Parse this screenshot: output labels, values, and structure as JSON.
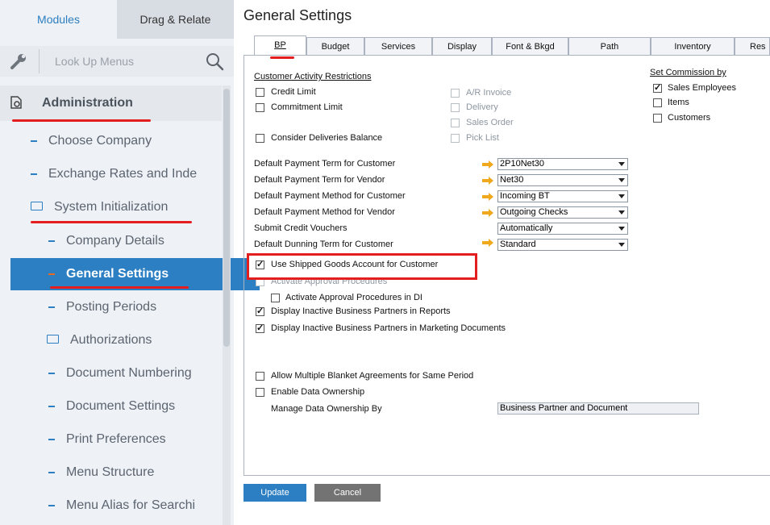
{
  "left": {
    "tabs": [
      {
        "label": "Modules"
      },
      {
        "label": "Drag & Relate"
      }
    ],
    "lookup_label": "Look Up Menus",
    "section": "Administration",
    "items": [
      {
        "label": "Choose Company"
      },
      {
        "label": "Exchange Rates and Inde"
      },
      {
        "label": "System Initialization"
      },
      {
        "label": "Company Details"
      },
      {
        "label": "General Settings"
      },
      {
        "label": "Posting Periods"
      },
      {
        "label": "Authorizations"
      },
      {
        "label": "Document Numbering"
      },
      {
        "label": "Document Settings"
      },
      {
        "label": "Print Preferences"
      },
      {
        "label": "Menu Structure"
      },
      {
        "label": "Menu Alias for Searchi"
      }
    ]
  },
  "right": {
    "title": "General Settings",
    "tabs": [
      {
        "label": "BP"
      },
      {
        "label": "Budget"
      },
      {
        "label": "Services"
      },
      {
        "label": "Display"
      },
      {
        "label": "Font & Bkgd"
      },
      {
        "label": "Path"
      },
      {
        "label": "Inventory"
      },
      {
        "label": "Res"
      }
    ],
    "car_header": "Customer Activity Restrictions",
    "car_items": [
      {
        "label": "Credit Limit",
        "checked": false
      },
      {
        "label": "Commitment Limit",
        "checked": false
      },
      {
        "label": "Consider Deliveries Balance",
        "checked": false
      }
    ],
    "car_docs": [
      {
        "label": "A/R Invoice"
      },
      {
        "label": "Delivery"
      },
      {
        "label": "Sales Order"
      },
      {
        "label": "Pick List"
      }
    ],
    "commission_header": "Set Commission by",
    "commission": [
      {
        "label": "Sales Employees",
        "checked": true
      },
      {
        "label": "Items",
        "checked": false
      },
      {
        "label": "Customers",
        "checked": false
      }
    ],
    "defaults": [
      {
        "label": "Default Payment Term for Customer",
        "value": "2P10Net30",
        "arrow": true
      },
      {
        "label": "Default Payment Term for Vendor",
        "value": "Net30",
        "arrow": true
      },
      {
        "label": "Default Payment Method for Customer",
        "value": "Incoming BT",
        "arrow": true
      },
      {
        "label": "Default Payment Method for Vendor",
        "value": "Outgoing Checks",
        "arrow": true
      },
      {
        "label": "Submit Credit Vouchers",
        "value": "Automatically",
        "arrow": false
      },
      {
        "label": "Default Dunning Term for Customer",
        "value": "Standard",
        "arrow": true
      }
    ],
    "options": [
      {
        "label": "Use Shipped Goods Account for Customer",
        "checked": true
      },
      {
        "label": "Activate Approval Procedures",
        "checked": false
      },
      {
        "label": "Activate Approval Procedures in DI",
        "checked": false
      },
      {
        "label": "Display Inactive Business Partners in Reports",
        "checked": true
      },
      {
        "label": "Display Inactive Business Partners in Marketing Documents",
        "checked": true
      },
      {
        "label": "Allow Multiple Blanket Agreements for Same Period",
        "checked": false
      },
      {
        "label": "Enable Data Ownership",
        "checked": false
      }
    ],
    "ownership_label": "Manage Data Ownership By",
    "ownership_value": "Business Partner and Document",
    "buttons": {
      "update": "Update",
      "cancel": "Cancel"
    }
  },
  "colors": {
    "accent": "#2c7fc2",
    "highlight": "#e41e1e",
    "selected": "#2c7fc2",
    "update_btn": "#2c7fc2",
    "cancel_btn": "#737373"
  },
  "icons": [
    "wrench-icon",
    "search-icon",
    "administration-icon",
    "folder-icon",
    "arrow-right-icon",
    "dropdown-arrow-icon"
  ]
}
